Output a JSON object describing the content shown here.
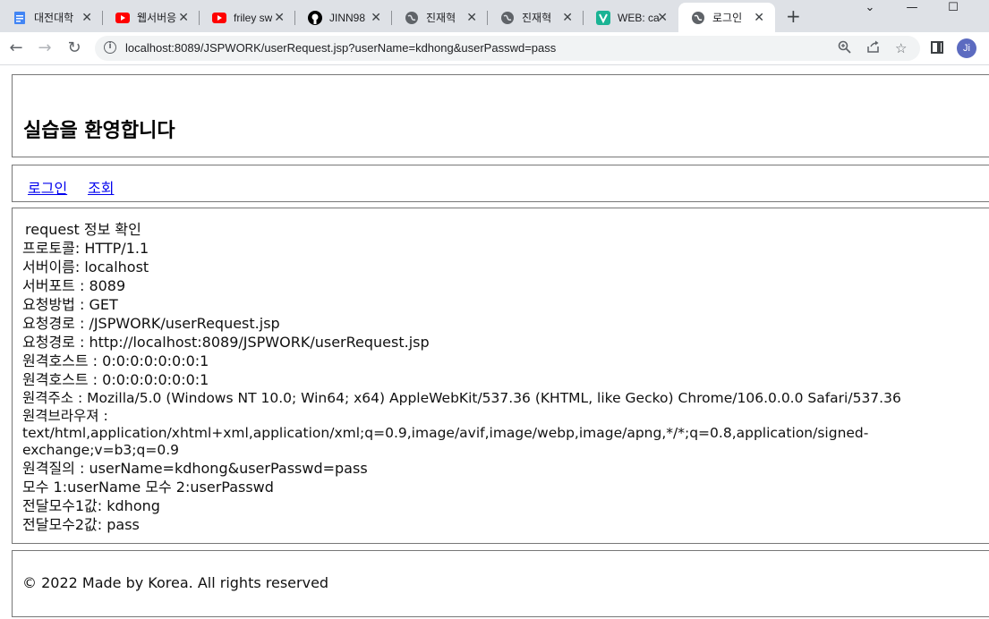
{
  "browser": {
    "tabs": [
      {
        "label": "대전대학",
        "icon": "doc-icon",
        "color": "#4285f4"
      },
      {
        "label": "웹서버응",
        "icon": "youtube-icon",
        "color": "#ff0000"
      },
      {
        "label": "friley sw",
        "icon": "youtube-icon",
        "color": "#ff0000"
      },
      {
        "label": "JINN98",
        "icon": "github-icon",
        "color": "#000000"
      },
      {
        "label": "진재혁",
        "icon": "globe-icon",
        "color": "#5f6368"
      },
      {
        "label": "진재혁",
        "icon": "globe-icon",
        "color": "#5f6368"
      },
      {
        "label": "WEB: ca",
        "icon": "v-icon",
        "color": "#1ab394"
      },
      {
        "label": "로그인",
        "icon": "globe-icon",
        "color": "#5f6368",
        "active": true
      }
    ],
    "new_tab": "+",
    "url": "localhost:8089/JSPWORK/userRequest.jsp?userName=kdhong&userPasswd=pass",
    "profile_initial": "Ji"
  },
  "page": {
    "title": "실습을 환영합니다",
    "nav": {
      "login": "로그인 ",
      "search": "조회"
    },
    "content": {
      "heading": "request 정보 확인",
      "protocol": "프로토콜: HTTP/1.1",
      "server_name": "서버이름: localhost",
      "server_port": "서버포트 : 8089",
      "method": "요청방법 : GET",
      "uri": "요청경로 : /JSPWORK/userRequest.jsp",
      "url": "요청경로 : http://localhost:8089/JSPWORK/userRequest.jsp",
      "remote_host_1": "원격호스트 : 0:0:0:0:0:0:0:1",
      "remote_host_2": "원격호스트 : 0:0:0:0:0:0:0:1",
      "remote_addr": "원격주소 : Mozilla/5.0 (Windows NT 10.0; Win64; x64) AppleWebKit/537.36 (KHTML, like Gecko) Chrome/106.0.0.0 Safari/537.36",
      "browser": "원격브라우져 : text/html,application/xhtml+xml,application/xml;q=0.9,image/avif,image/webp,image/apng,*/*;q=0.8,application/signed-exchange;v=b3;q=0.9",
      "query": "원격질의 : userName=kdhong&userPasswd=pass",
      "params": "모수 1:userName 모수 2:userPasswd",
      "param1": "전달모수1값: kdhong",
      "param2": "전달모수2값: pass"
    },
    "footer": "© 2022 Made by Korea. All rights reserved"
  }
}
